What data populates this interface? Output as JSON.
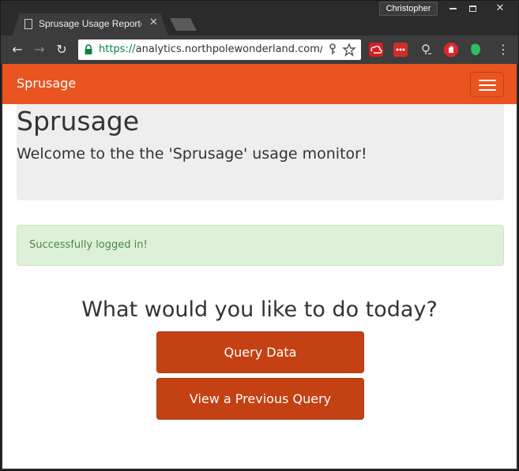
{
  "browser": {
    "profile_name": "Christopher",
    "window_controls": {
      "minimize_icon": "minimize-icon",
      "maximize_icon": "maximize-icon",
      "close_glyph": "✕"
    },
    "tab": {
      "title": "Sprusage Usage Reporter",
      "close_glyph": "✕",
      "icon": "page-icon"
    },
    "toolbar": {
      "back_glyph": "←",
      "forward_glyph": "→",
      "reload_glyph": "↻",
      "url_scheme": "https://",
      "url_rest": "analytics.northpolewonderland.com/index.php",
      "menu_glyph": "⋮"
    },
    "colors": {
      "accent": "#e95420",
      "button": "#c34113",
      "alert_bg": "#dff0d8",
      "alert_text": "#468847"
    }
  },
  "navbar": {
    "brand": "Sprusage",
    "menu_icon": "hamburger-icon"
  },
  "jumbotron": {
    "title": "Sprusage",
    "lead": "Welcome to the the 'Sprusage' usage monitor!"
  },
  "alert": {
    "message": "Successfully logged in!"
  },
  "main": {
    "question": "What would you like to do today?",
    "buttons": {
      "query": "Query Data",
      "previous": "View a Previous Query"
    }
  }
}
